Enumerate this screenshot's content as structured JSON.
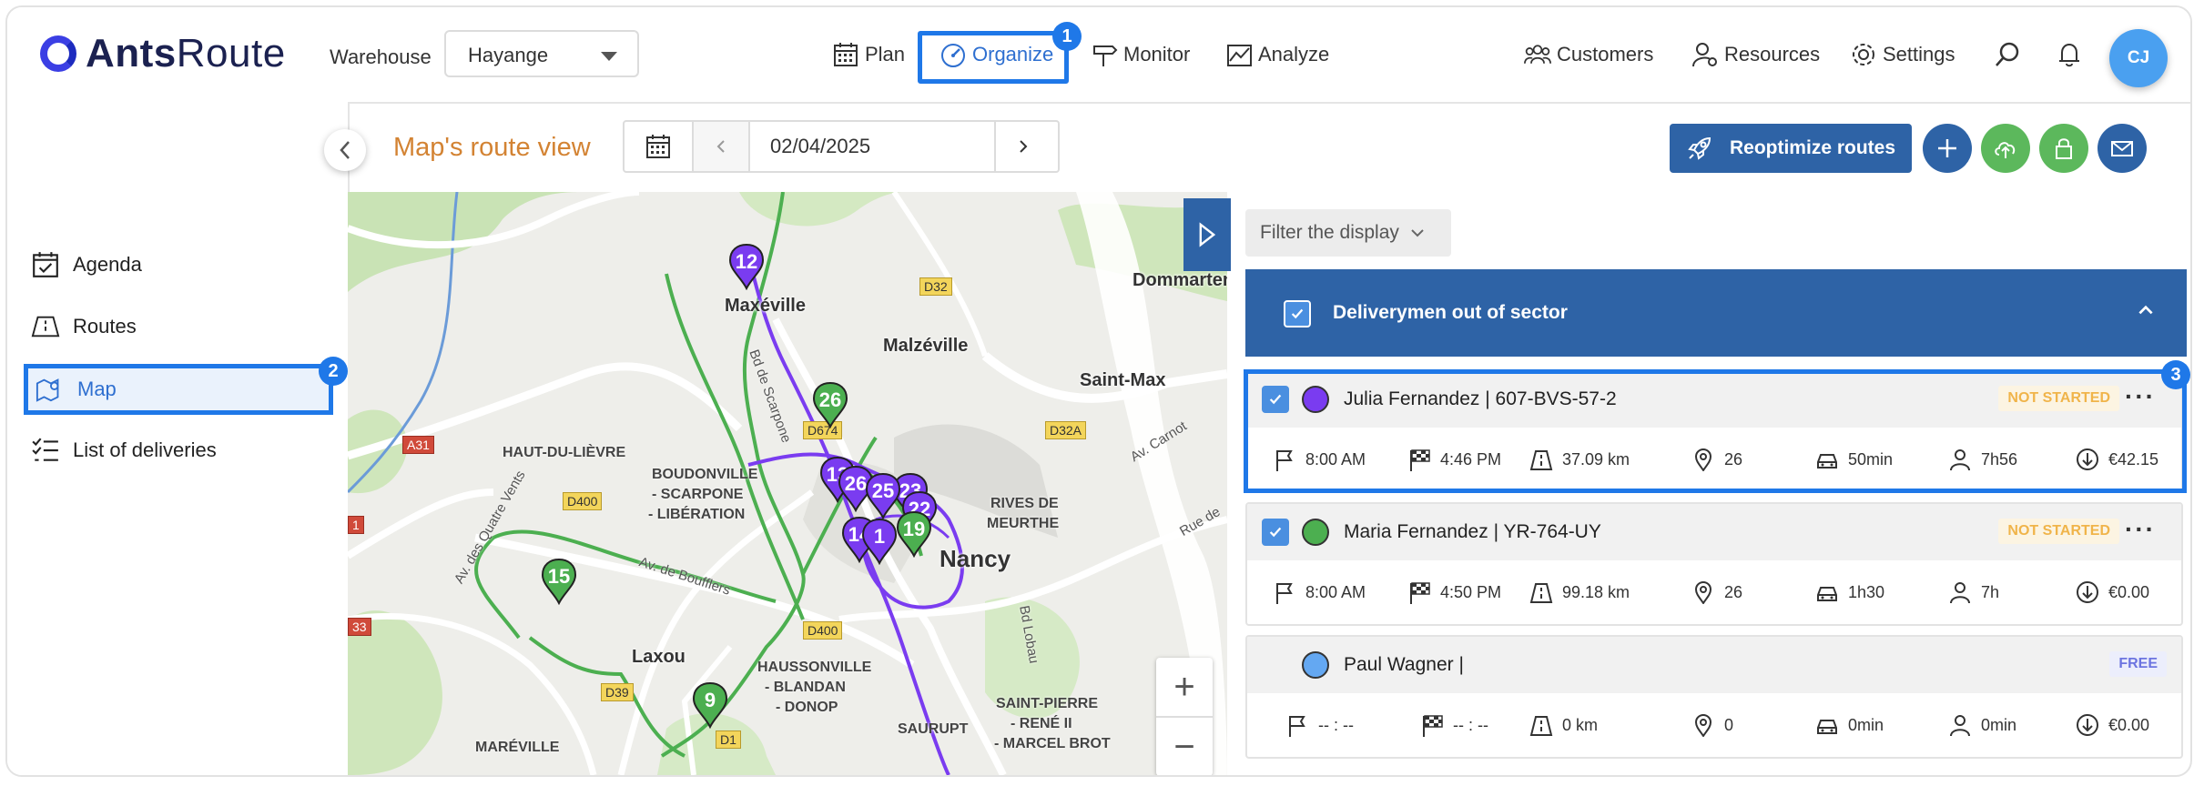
{
  "header": {
    "logo_text_bold": "Ants",
    "logo_text_light": "Route",
    "warehouse_label": "Warehouse",
    "warehouse_value": "Hayange",
    "nav": {
      "plan": "Plan",
      "organize": "Organize",
      "monitor": "Monitor",
      "analyze": "Analyze",
      "customers": "Customers",
      "resources": "Resources",
      "settings": "Settings"
    },
    "avatar_initials": "CJ"
  },
  "callouts": {
    "one": "1",
    "two": "2",
    "three": "3"
  },
  "sidebar": {
    "items": [
      {
        "label": "Agenda",
        "icon": "calendar-check-icon"
      },
      {
        "label": "Routes",
        "icon": "route-sign-icon"
      },
      {
        "label": "Map",
        "icon": "map-pin-icon",
        "active": true
      },
      {
        "label": "List of deliveries",
        "icon": "checklist-icon"
      }
    ]
  },
  "toolbar": {
    "title": "Map's route view",
    "date": "02/04/2025",
    "reoptimize_label": "Reoptimize routes"
  },
  "map": {
    "places": [
      "Maxéville",
      "Malzéville",
      "Dommartemont",
      "Saint-Max",
      "HAUT-DU-LIÈVRE",
      "BOUDONVILLE",
      "- SCARPONE",
      "- LIBÉRATION",
      "RIVES DE",
      "MEURTHE",
      "Nancy",
      "Laxou",
      "HAUSSONVILLE",
      "- BLANDAN",
      "- DONOP",
      "SAURUPT",
      "SAINT-PIERRE",
      "- RENÉ II",
      "- MARCEL BROT",
      "MARÉVILLE"
    ],
    "streets": [
      "Bd de Scarpone",
      "Av. des Quatre Vents",
      "Av. de Boufflers",
      "Av. Carnot",
      "Rue de",
      "Bd Lobau"
    ],
    "shields": [
      "D32",
      "D674",
      "D32A",
      "A31",
      "D400",
      "D400",
      "D39",
      "D1",
      "33",
      "1",
      "D32"
    ],
    "pins": [
      {
        "label": "12",
        "color": "#7a3cf0"
      },
      {
        "label": "26",
        "color": "#4caf50"
      },
      {
        "label": "13",
        "color": "#7a3cf0"
      },
      {
        "label": "26",
        "color": "#7a3cf0"
      },
      {
        "label": "23",
        "color": "#7a3cf0"
      },
      {
        "label": "25",
        "color": "#7a3cf0"
      },
      {
        "label": "22",
        "color": "#7a3cf0"
      },
      {
        "label": "14",
        "color": "#7a3cf0"
      },
      {
        "label": "1",
        "color": "#7a3cf0"
      },
      {
        "label": "19",
        "color": "#4caf50"
      },
      {
        "label": "15",
        "color": "#4caf50"
      },
      {
        "label": "9",
        "color": "#4caf50"
      }
    ],
    "zoom_in": "+",
    "zoom_out": "−"
  },
  "panel": {
    "filter_label": "Filter the display",
    "sector_title": "Deliverymen out of sector",
    "drivers": [
      {
        "name": "Julia Fernandez | 607-BVS-57-2",
        "color": "#7a3cf0",
        "status": "NOT STARTED",
        "checked": true,
        "start": "8:00 AM",
        "end": "4:46 PM",
        "distance": "37.09 km",
        "stops": "26",
        "drive": "50min",
        "work": "7h56",
        "cost": "€42.15"
      },
      {
        "name": "Maria Fernandez | YR-764-UY",
        "color": "#4caf50",
        "status": "NOT STARTED",
        "checked": true,
        "start": "8:00 AM",
        "end": "4:50 PM",
        "distance": "99.18 km",
        "stops": "26",
        "drive": "1h30",
        "work": "7h",
        "cost": "€0.00"
      },
      {
        "name": "Paul Wagner |",
        "color": "#64a8f2",
        "status": "FREE",
        "checked": false,
        "start": "-- : --",
        "end": "-- : --",
        "distance": "0 km",
        "stops": "0",
        "drive": "0min",
        "work": "0min",
        "cost": "€0.00"
      }
    ]
  }
}
